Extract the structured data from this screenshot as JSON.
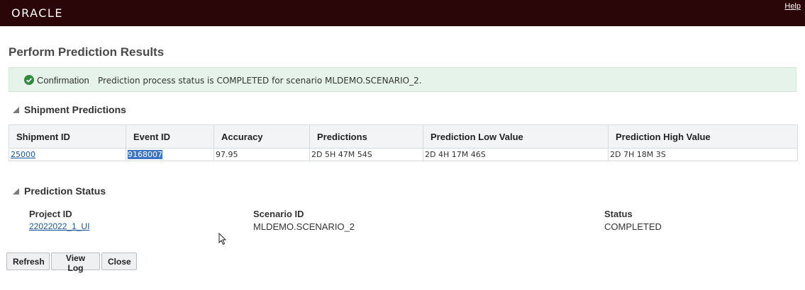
{
  "header": {
    "logo": "ORACLE",
    "help_label": "Help"
  },
  "page": {
    "title": "Perform Prediction Results"
  },
  "confirmation": {
    "label": "Confirmation",
    "message": "Prediction process status is COMPLETED for scenario MLDEMO.SCENARIO_2.",
    "icon": "check-circle-icon",
    "color": "#e5f3ea"
  },
  "shipment_section": {
    "title": "Shipment Predictions",
    "columns": [
      "Shipment ID",
      "Event ID",
      "Accuracy",
      "Predictions",
      "Prediction Low Value",
      "Prediction High Value"
    ],
    "rows": [
      [
        "25000",
        "9168007",
        "97.95",
        "2D 5H 47M 54S",
        "2D 4H 17M 46S",
        "2D 7H 18M 3S"
      ]
    ]
  },
  "status_section": {
    "title": "Prediction Status",
    "project_id_label": "Project ID",
    "project_id_value": "22022022_1_UI",
    "scenario_id_label": "Scenario ID",
    "scenario_id_value": "MLDEMO.SCENARIO_2",
    "status_label": "Status",
    "status_value": "COMPLETED"
  },
  "buttons": {
    "refresh": "Refresh",
    "view_log": "View Log",
    "close": "Close"
  }
}
